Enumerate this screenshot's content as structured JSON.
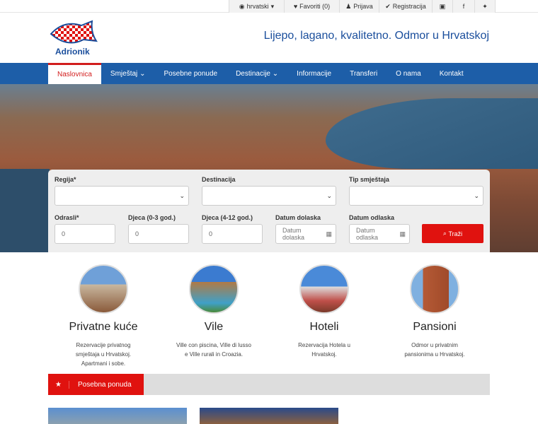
{
  "topbar": {
    "language": "hrvatski",
    "favorites": "Favoriti (0)",
    "login": "Prijava",
    "register": "Registracija"
  },
  "logo": {
    "text": "Adrionik"
  },
  "slogan": "Lijepo, lagano, kvalitetno. Odmor u Hrvatskoj",
  "nav": [
    "Naslovnica",
    "Smještaj",
    "Posebne ponude",
    "Destinacije",
    "Informacije",
    "Transferi",
    "O nama",
    "Kontakt"
  ],
  "form": {
    "region_label": "Regija*",
    "destination_label": "Destinacija",
    "type_label": "Tip smještaja",
    "adults_label": "Odrasli*",
    "adults": "0",
    "kids03_label": "Djeca (0-3 god.)",
    "kids03": "0",
    "kids412_label": "Djeca (4-12 god.)",
    "kids412": "0",
    "arrival_label": "Datum dolaska",
    "arrival_placeholder": "Datum dolaska",
    "departure_label": "Datum odlaska",
    "departure_placeholder": "Datum odlaska",
    "search": "Traži"
  },
  "categories": [
    {
      "title": "Privatne kuće",
      "desc": "Rezervacije privatnog smještaja u Hrvatskoj. Apartmani i sobe."
    },
    {
      "title": "Vile",
      "desc": "Ville con piscina, Ville di lusso e Ville rurali in Croazia."
    },
    {
      "title": "Hoteli",
      "desc": "Rezervacija Hotela u Hrvatskoj."
    },
    {
      "title": "Pansioni",
      "desc": "Odmor u privatnim pansionima u Hrvatskoj."
    }
  ],
  "special": {
    "label": "Posebna ponuda"
  }
}
